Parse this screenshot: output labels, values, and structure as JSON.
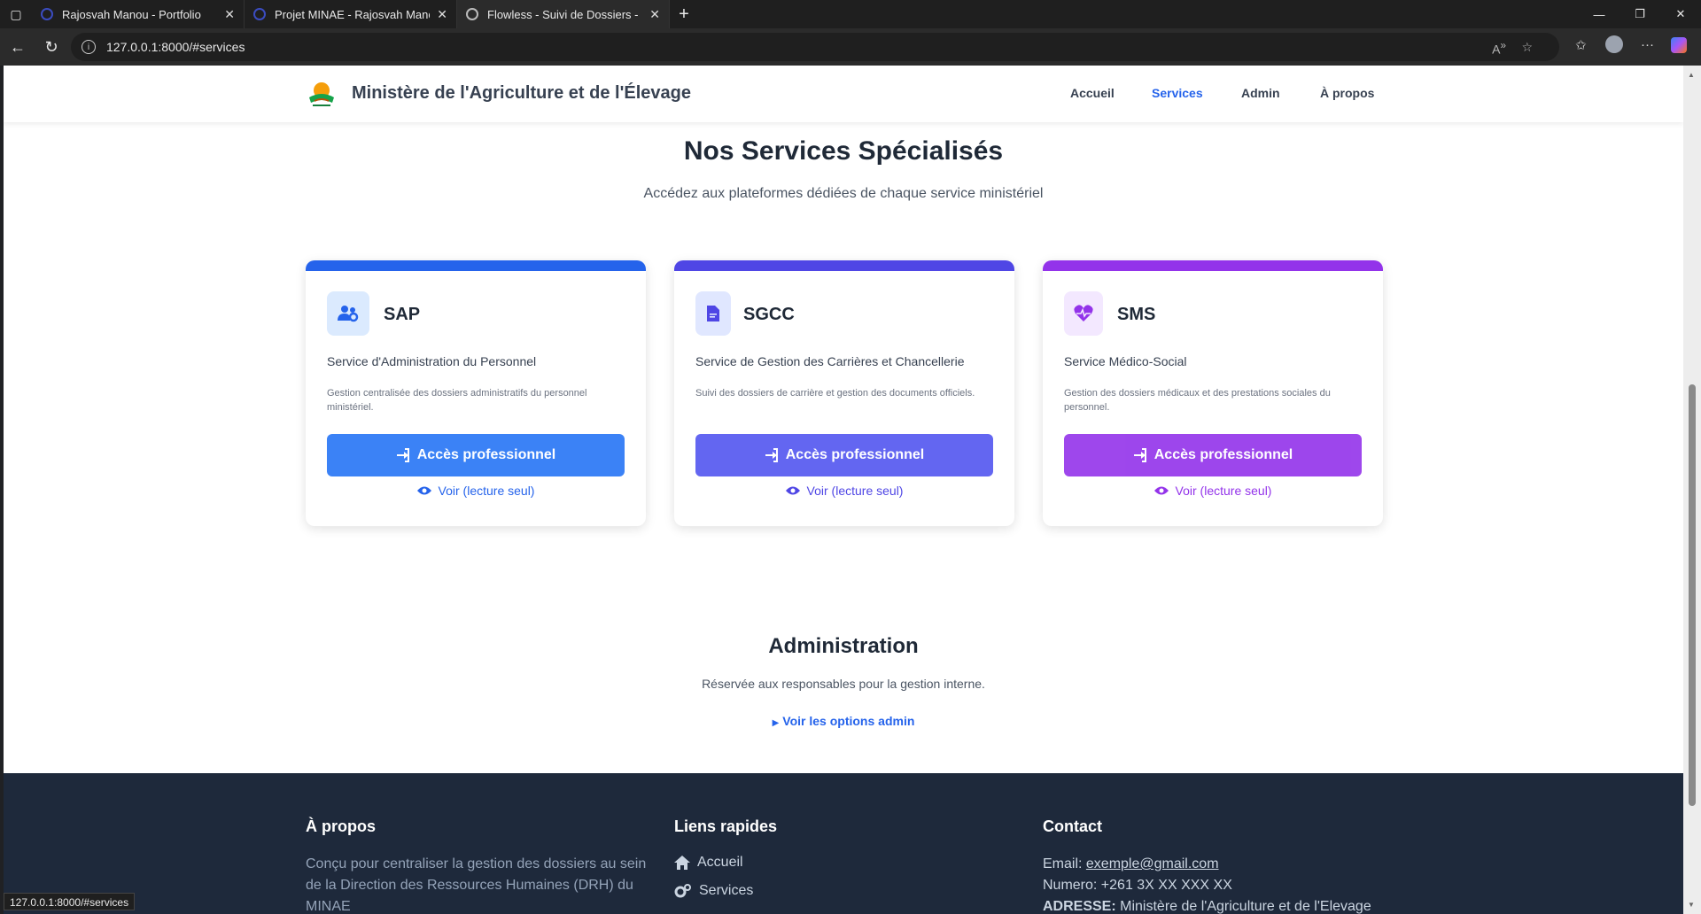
{
  "browser": {
    "tabs": [
      {
        "title": "Rajosvah Manou - Portfolio"
      },
      {
        "title": "Projet MINAE - Rajosvah Manou"
      },
      {
        "title": "Flowless - Suivi de Dossiers - MIN"
      }
    ],
    "url": "127.0.0.1:8000/#services",
    "status_url": "127.0.0.1:8000/#services"
  },
  "header": {
    "brand": "Ministère de l'Agriculture et de l'Élevage",
    "nav": [
      "Accueil",
      "Services",
      "Admin",
      "À propos"
    ],
    "active_nav": "Services"
  },
  "services": {
    "title": "Nos Services Spécialisés",
    "subtitle": "Accédez aux plateformes dédiées de chaque service ministériel",
    "cards": [
      {
        "code": "SAP",
        "name": "Service d'Administration du Personnel",
        "description": "Gestion centralisée des dossiers administratifs du personnel ministériel.",
        "button": "Accès professionnel",
        "link": "Voir (lecture seul)",
        "accent": "#3b82f6",
        "icon": "users-cog-icon"
      },
      {
        "code": "SGCC",
        "name": "Service de Gestion des Carrières et Chancellerie",
        "description": "Suivi des dossiers de carrière et gestion des documents officiels.",
        "button": "Accès professionnel",
        "link": "Voir (lecture seul)",
        "accent": "#6366f1",
        "icon": "file-icon"
      },
      {
        "code": "SMS",
        "name": "Service Médico-Social",
        "description": "Gestion des dossiers médicaux et des prestations sociales du personnel.",
        "button": "Accès professionnel",
        "link": "Voir (lecture seul)",
        "accent": "#9333ea",
        "icon": "heart-pulse-icon"
      }
    ]
  },
  "admin": {
    "title": "Administration",
    "subtitle": "Réservée aux responsables pour la gestion interne.",
    "toggle": "Voir les options admin"
  },
  "footer": {
    "about_title": "À propos",
    "about_text": "Conçu pour centraliser la gestion des dossiers au sein de la Direction des Ressources Humaines (DRH) du MINAE",
    "links_title": "Liens rapides",
    "links": [
      "Accueil",
      "Services"
    ],
    "contact_title": "Contact",
    "email_label": "Email:",
    "email": "exemple@gmail.com",
    "phone": "Numero: +261 3X XX XXX XX",
    "address_label": "ADRESSE:",
    "address": "Ministère de l'Agriculture et de l'Elevage"
  }
}
